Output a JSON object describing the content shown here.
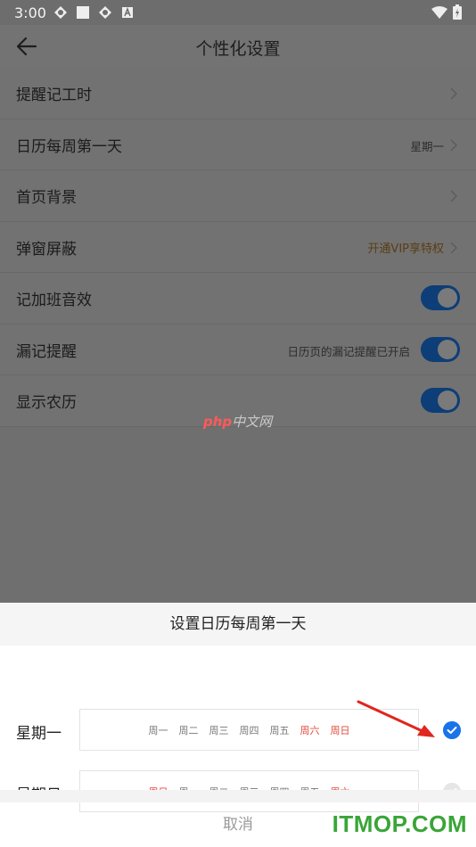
{
  "status_bar": {
    "time": "3:00"
  },
  "header": {
    "title": "个性化设置"
  },
  "settings": [
    {
      "label": "提醒记工时",
      "value": "",
      "type": "nav"
    },
    {
      "label": "日历每周第一天",
      "value": "星期一",
      "type": "nav"
    },
    {
      "label": "首页背景",
      "value": "",
      "type": "nav"
    },
    {
      "label": "弹窗屏蔽",
      "value": "开通VIP享特权",
      "type": "nav"
    },
    {
      "label": "记加班音效",
      "value": "",
      "type": "toggle",
      "on": true
    },
    {
      "label": "漏记提醒",
      "value": "日历页的漏记提醒已开启",
      "type": "toggle",
      "on": true
    },
    {
      "label": "显示农历",
      "value": "",
      "type": "toggle",
      "on": true
    }
  ],
  "watermark": {
    "php": "php",
    "cn": "中文网"
  },
  "sheet": {
    "title": "设置日历每周第一天",
    "options": [
      {
        "name": "星期一",
        "days": [
          "周一",
          "周二",
          "周三",
          "周四",
          "周五",
          "周六",
          "周日"
        ],
        "selected": true
      },
      {
        "name": "星期日",
        "days": [
          "周日",
          "周一",
          "周二",
          "周三",
          "周四",
          "周五",
          "周六"
        ],
        "selected": false
      }
    ],
    "cancel": "取消"
  },
  "site_watermark": "ITMOP.COM",
  "colors": {
    "accent": "#1a73e8",
    "weekend": "#e4493c",
    "brand_green": "#39a537"
  }
}
